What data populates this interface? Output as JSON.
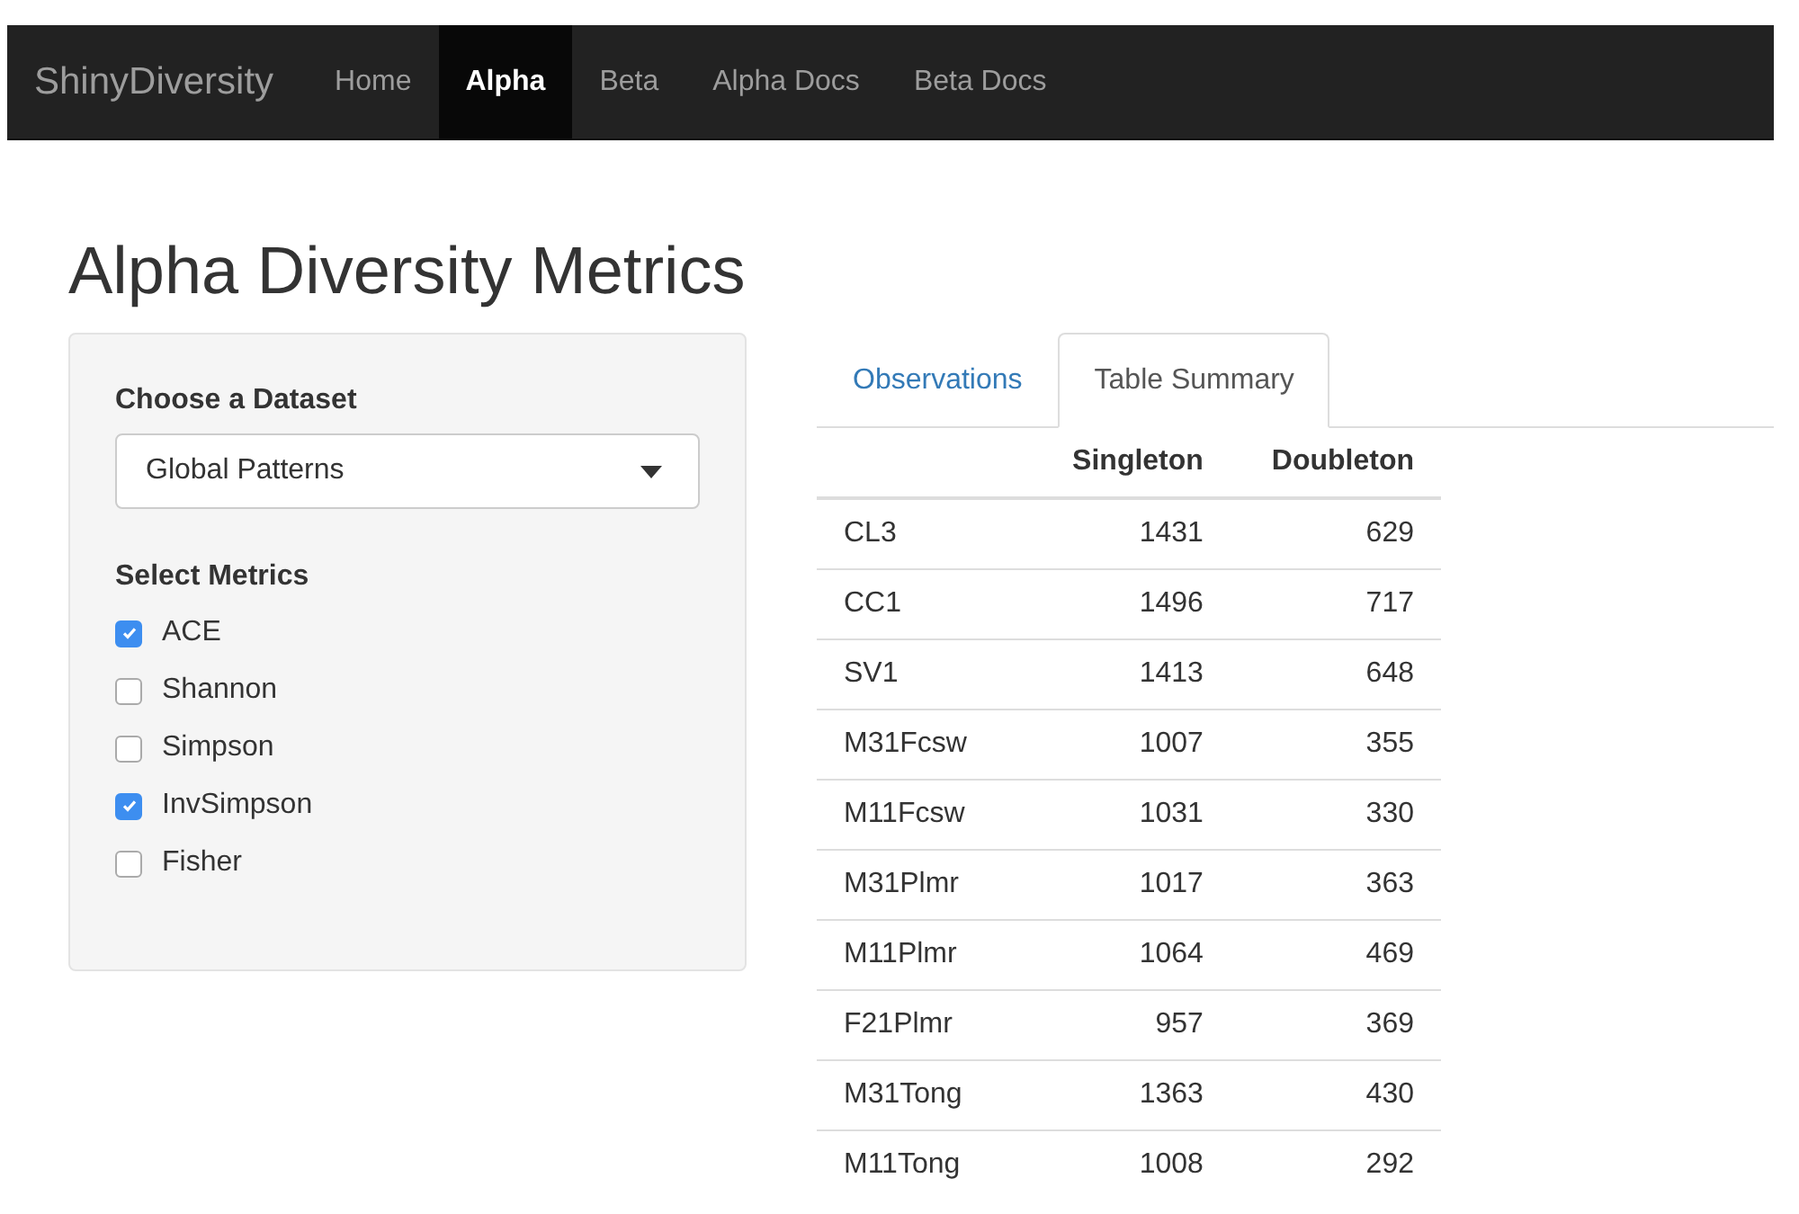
{
  "navbar": {
    "brand": "ShinyDiversity",
    "items": [
      {
        "label": "Home",
        "selected": false
      },
      {
        "label": "Alpha",
        "selected": true
      },
      {
        "label": "Beta",
        "selected": false
      },
      {
        "label": "Alpha Docs",
        "selected": false
      },
      {
        "label": "Beta Docs",
        "selected": false
      }
    ]
  },
  "page_title": "Alpha Diversity Metrics",
  "sidebar": {
    "dataset_label": "Choose a Dataset",
    "dataset_value": "Global Patterns",
    "metrics_label": "Select Metrics",
    "metrics": [
      {
        "label": "ACE",
        "checked": true
      },
      {
        "label": "Shannon",
        "checked": false
      },
      {
        "label": "Simpson",
        "checked": false
      },
      {
        "label": "InvSimpson",
        "checked": true
      },
      {
        "label": "Fisher",
        "checked": false
      }
    ]
  },
  "tabs": [
    {
      "label": "Observations",
      "selected": false
    },
    {
      "label": "Table Summary",
      "selected": true
    }
  ],
  "table": {
    "columns": [
      "Singleton",
      "Doubleton"
    ],
    "rows": [
      {
        "label": "CL3",
        "values": [
          "1431",
          "629"
        ]
      },
      {
        "label": "CC1",
        "values": [
          "1496",
          "717"
        ]
      },
      {
        "label": "SV1",
        "values": [
          "1413",
          "648"
        ]
      },
      {
        "label": "M31Fcsw",
        "values": [
          "1007",
          "355"
        ]
      },
      {
        "label": "M11Fcsw",
        "values": [
          "1031",
          "330"
        ]
      },
      {
        "label": "M31Plmr",
        "values": [
          "1017",
          "363"
        ]
      },
      {
        "label": "M11Plmr",
        "values": [
          "1064",
          "469"
        ]
      },
      {
        "label": "F21Plmr",
        "values": [
          "957",
          "369"
        ]
      },
      {
        "label": "M31Tong",
        "values": [
          "1363",
          "430"
        ]
      },
      {
        "label": "M11Tong",
        "values": [
          "1008",
          "292"
        ]
      }
    ]
  }
}
